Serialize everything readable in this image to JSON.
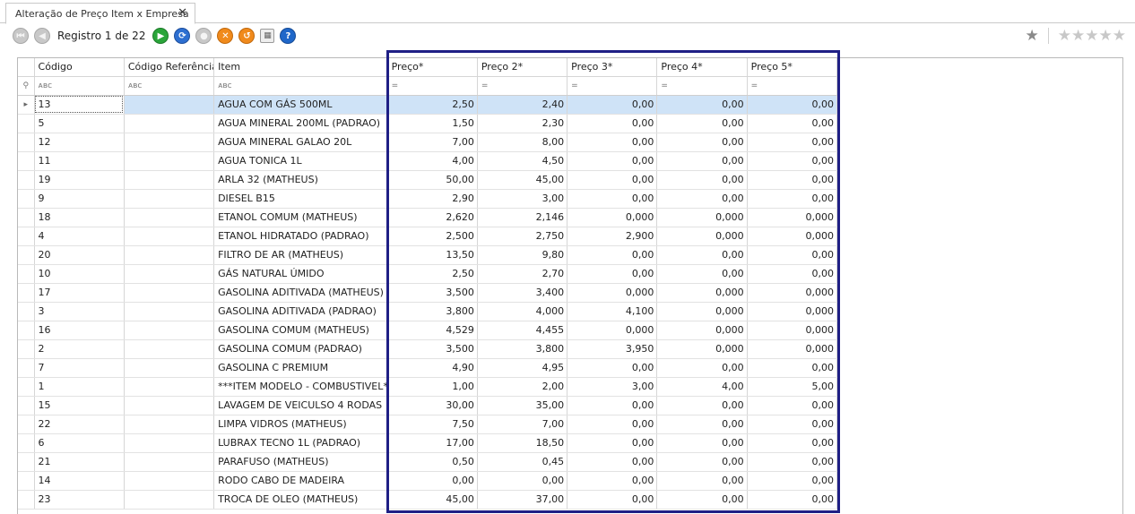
{
  "tab": {
    "title": "Alteração de Preço Item x Empresa",
    "close": "✕"
  },
  "toolbar": {
    "registro_label": "Registro 1 de 22",
    "buttons": [
      {
        "name": "first-record-icon",
        "glyph": "⏮",
        "style": "gray"
      },
      {
        "name": "previous-record-icon",
        "glyph": "◀",
        "style": "gray"
      },
      {
        "name": "next-record-icon",
        "glyph": "▶",
        "style": "green"
      },
      {
        "name": "refresh-icon",
        "glyph": "⟳",
        "style": "blue"
      },
      {
        "name": "disabled-action-icon",
        "glyph": "●",
        "style": "gray"
      },
      {
        "name": "cancel-icon",
        "glyph": "✕",
        "style": "orange"
      },
      {
        "name": "undo-icon",
        "glyph": "↺",
        "style": "orange"
      },
      {
        "name": "grid-view-icon",
        "glyph": "▦",
        "style": "grid"
      },
      {
        "name": "help-icon",
        "glyph": "?",
        "style": "help"
      }
    ]
  },
  "rating": {
    "favorite": "★",
    "stars": "★★★★★"
  },
  "grid": {
    "columns": [
      "Código",
      "Código Referência",
      "Item",
      "Preço*",
      "Preço 2*",
      "Preço 3*",
      "Preço 4*",
      "Preço 5*"
    ],
    "filter_text_icon": "ᴀʙc",
    "filter_num_icon": "=",
    "filter_row_icon": "⚲",
    "selected_row_marker": "▸",
    "rows": [
      [
        "13",
        "",
        "AGUA COM GÁS 500ML",
        "2,50",
        "2,40",
        "0,00",
        "0,00",
        "0,00"
      ],
      [
        "5",
        "",
        "AGUA MINERAL 200ML (PADRAO)",
        "1,50",
        "2,30",
        "0,00",
        "0,00",
        "0,00"
      ],
      [
        "12",
        "",
        "AGUA MINERAL GALAO 20L",
        "7,00",
        "8,00",
        "0,00",
        "0,00",
        "0,00"
      ],
      [
        "11",
        "",
        "AGUA TONICA 1L",
        "4,00",
        "4,50",
        "0,00",
        "0,00",
        "0,00"
      ],
      [
        "19",
        "",
        "ARLA 32 (MATHEUS)",
        "50,00",
        "45,00",
        "0,00",
        "0,00",
        "0,00"
      ],
      [
        "9",
        "",
        "DIESEL B15",
        "2,90",
        "3,00",
        "0,00",
        "0,00",
        "0,00"
      ],
      [
        "18",
        "",
        "ETANOL COMUM (MATHEUS)",
        "2,620",
        "2,146",
        "0,000",
        "0,000",
        "0,000"
      ],
      [
        "4",
        "",
        "ETANOL HIDRATADO (PADRAO)",
        "2,500",
        "2,750",
        "2,900",
        "0,000",
        "0,000"
      ],
      [
        "20",
        "",
        "FILTRO DE AR (MATHEUS)",
        "13,50",
        "9,80",
        "0,00",
        "0,00",
        "0,00"
      ],
      [
        "10",
        "",
        "GÁS NATURAL ÚMIDO",
        "2,50",
        "2,70",
        "0,00",
        "0,00",
        "0,00"
      ],
      [
        "17",
        "",
        "GASOLINA ADITIVADA (MATHEUS)",
        "3,500",
        "3,400",
        "0,000",
        "0,000",
        "0,000"
      ],
      [
        "3",
        "",
        "GASOLINA ADITIVADA (PADRAO)",
        "3,800",
        "4,000",
        "4,100",
        "0,000",
        "0,000"
      ],
      [
        "16",
        "",
        "GASOLINA COMUM (MATHEUS)",
        "4,529",
        "4,455",
        "0,000",
        "0,000",
        "0,000"
      ],
      [
        "2",
        "",
        "GASOLINA COMUM (PADRAO)",
        "3,500",
        "3,800",
        "3,950",
        "0,000",
        "0,000"
      ],
      [
        "7",
        "",
        "GASOLINA C PREMIUM",
        "4,90",
        "4,95",
        "0,00",
        "0,00",
        "0,00"
      ],
      [
        "1",
        "",
        "***ITEM MODELO - COMBUSTIVEL***",
        "1,00",
        "2,00",
        "3,00",
        "4,00",
        "5,00"
      ],
      [
        "15",
        "",
        "LAVAGEM DE VEICULSO 4 RODAS",
        "30,00",
        "35,00",
        "0,00",
        "0,00",
        "0,00"
      ],
      [
        "22",
        "",
        "LIMPA VIDROS (MATHEUS)",
        "7,50",
        "7,00",
        "0,00",
        "0,00",
        "0,00"
      ],
      [
        "6",
        "",
        "LUBRAX TECNO 1L (PADRAO)",
        "17,00",
        "18,50",
        "0,00",
        "0,00",
        "0,00"
      ],
      [
        "21",
        "",
        "PARAFUSO (MATHEUS)",
        "0,50",
        "0,45",
        "0,00",
        "0,00",
        "0,00"
      ],
      [
        "14",
        "",
        "RODO CABO DE MADEIRA",
        "0,00",
        "0,00",
        "0,00",
        "0,00",
        "0,00"
      ],
      [
        "23",
        "",
        "TROCA DE OLEO (MATHEUS)",
        "45,00",
        "37,00",
        "0,00",
        "0,00",
        "0,00"
      ]
    ]
  }
}
